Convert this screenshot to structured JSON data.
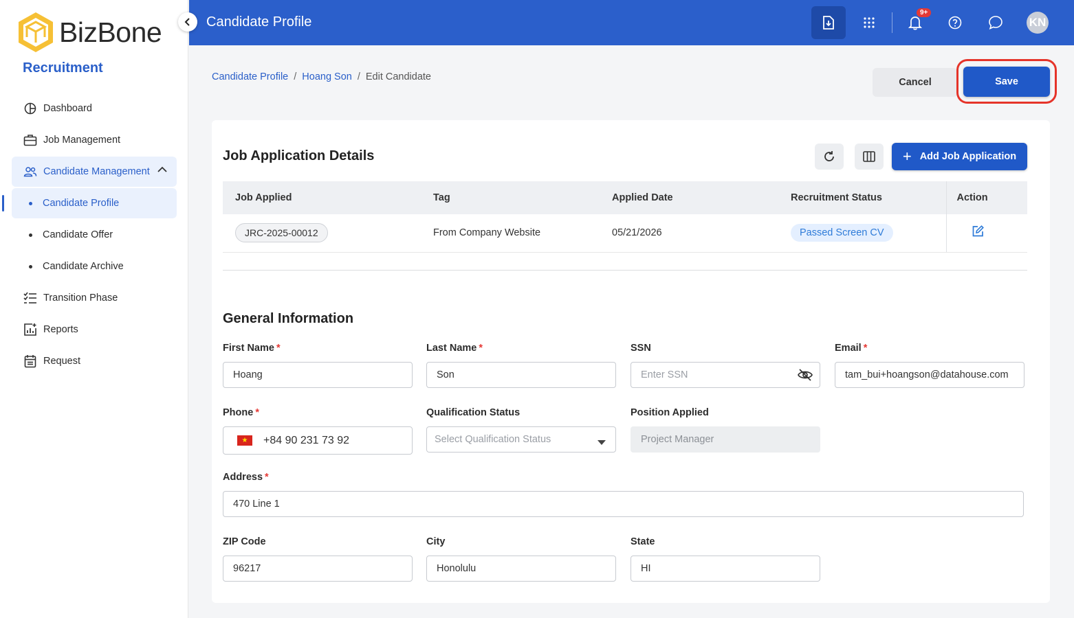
{
  "brand": {
    "logo_text": "BizBone",
    "app_name": "Recruitment"
  },
  "sidebar": {
    "items": [
      {
        "label": "Dashboard",
        "icon": "dashboard-icon"
      },
      {
        "label": "Job Management",
        "icon": "briefcase-icon"
      },
      {
        "label": "Candidate Management",
        "icon": "users-icon"
      },
      {
        "label": "Candidate Profile"
      },
      {
        "label": "Candidate Offer"
      },
      {
        "label": "Candidate Archive"
      },
      {
        "label": "Transition Phase",
        "icon": "checklist-icon"
      },
      {
        "label": "Reports",
        "icon": "report-icon"
      },
      {
        "label": "Request",
        "icon": "calendar-icon"
      }
    ]
  },
  "header": {
    "title": "Candidate Profile",
    "notifications_badge": "9+",
    "avatar_initials": "KN"
  },
  "breadcrumb": {
    "item1": "Candidate Profile",
    "item2": "Hoang Son",
    "item3": "Edit Candidate",
    "separator": "/"
  },
  "actions": {
    "cancel": "Cancel",
    "save": "Save"
  },
  "job_section": {
    "title": "Job Application Details",
    "add_button": "Add Job Application",
    "columns": [
      "Job Applied",
      "Tag",
      "Applied Date",
      "Recruitment Status",
      "Action"
    ],
    "rows": [
      {
        "job": "JRC-2025-00012",
        "tag": "From Company Website",
        "date": "05/21/2026",
        "status": "Passed Screen CV"
      }
    ]
  },
  "general": {
    "title": "General Information",
    "first_name": {
      "label": "First Name",
      "value": "Hoang"
    },
    "last_name": {
      "label": "Last Name",
      "value": "Son"
    },
    "ssn": {
      "label": "SSN",
      "placeholder": "Enter SSN"
    },
    "email": {
      "label": "Email",
      "value": "tam_bui+hoangson@datahouse.com"
    },
    "phone": {
      "label": "Phone",
      "value": "+84 90 231 73 92"
    },
    "qualification": {
      "label": "Qualification Status",
      "placeholder": "Select Qualification Status"
    },
    "position": {
      "label": "Position Applied",
      "value": "Project Manager"
    },
    "address": {
      "label": "Address",
      "value": "470 Line 1"
    },
    "zip": {
      "label": "ZIP Code",
      "value": "96217"
    },
    "city": {
      "label": "City",
      "value": "Honolulu"
    },
    "state": {
      "label": "State",
      "value": "HI"
    },
    "required_mark": "*"
  },
  "colors": {
    "primary": "#2b5fcb",
    "save_highlight": "#e5342a",
    "status_text": "#2e7bd8"
  }
}
